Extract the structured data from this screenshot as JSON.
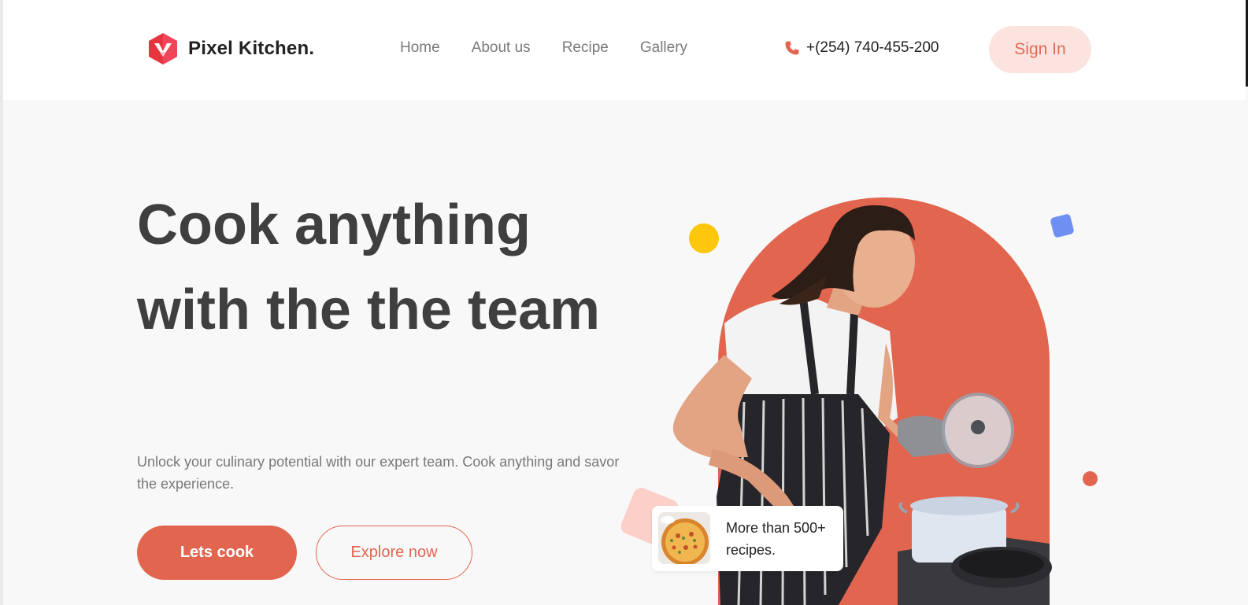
{
  "header": {
    "brand": "Pixel Kitchen.",
    "logo_icon": "hexagon-logo-icon",
    "nav": [
      {
        "label": "Home"
      },
      {
        "label": "About us"
      },
      {
        "label": "Recipe"
      },
      {
        "label": "Gallery"
      }
    ],
    "phone_icon": "phone-icon",
    "phone": "+(254) 740-455-200",
    "signin_label": "Sign In"
  },
  "hero": {
    "title": "Cook anything with the the team",
    "description": "Unlock your culinary potential with our expert team. Cook anything and savor the experience.",
    "primary_button": "Lets cook",
    "secondary_button": "Explore now",
    "recipe_card": {
      "image": "pizza-thumbnail",
      "text": "More than 500+ recipes."
    }
  },
  "colors": {
    "accent": "#e2654f",
    "accent_soft": "#fbe3e0",
    "yellow": "#fdc70c",
    "blue": "#6f8ff3",
    "title_text": "#3f3f3f",
    "muted_text": "#787878",
    "background": "#f8f8f8"
  }
}
